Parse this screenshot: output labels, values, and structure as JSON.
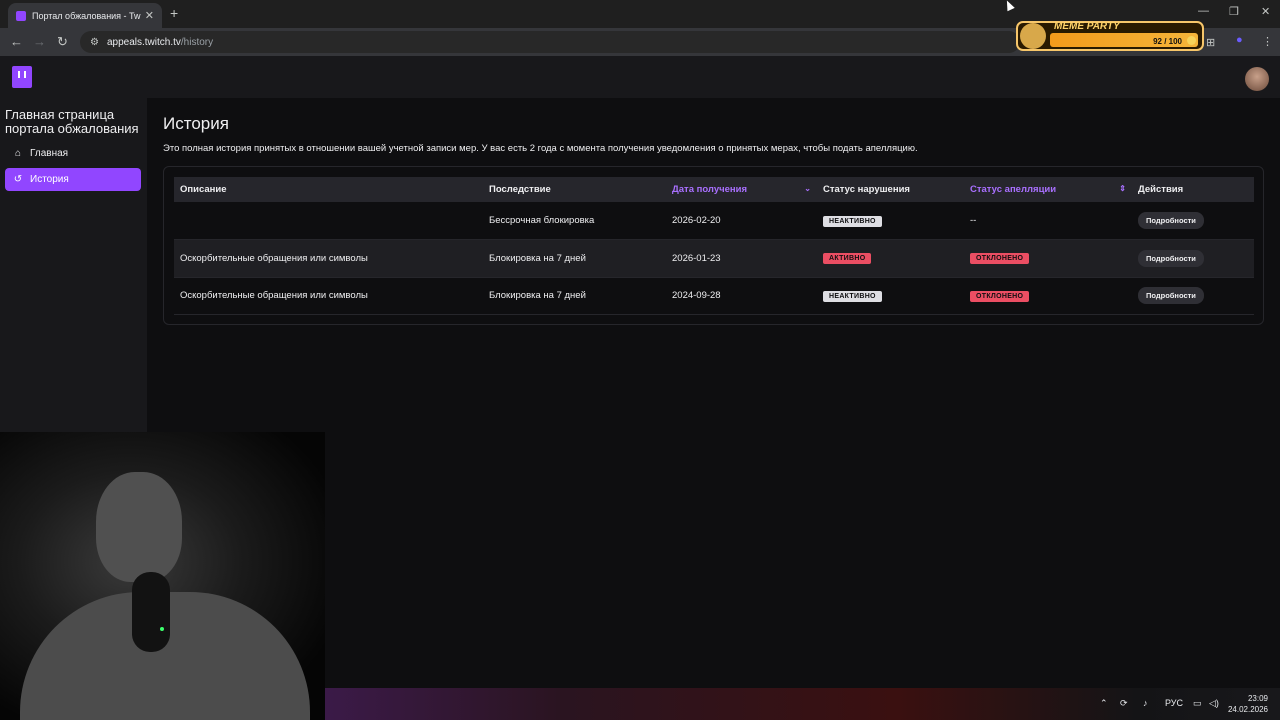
{
  "browser": {
    "tab_title": "Портал обжалования - Twitch",
    "tab_close": "✕",
    "new_tab": "+",
    "url_host": "appeals.twitch.tv",
    "url_path": "/history",
    "icons": [
      "back-icon",
      "forward-icon",
      "reload-icon",
      "site-settings-icon",
      "minimize-icon",
      "maximize-icon",
      "close-icon"
    ]
  },
  "extension": {
    "label": "MEME PARTY",
    "count": "92 / 100"
  },
  "sidebar": {
    "title": "Главная страница портала обжалования",
    "items": [
      {
        "label": "Главная",
        "icon": "home-icon"
      },
      {
        "label": "История",
        "icon": "history-icon",
        "active": true
      }
    ]
  },
  "main": {
    "title": "История",
    "description": "Это полная история принятых в отношении вашей учетной записи мер. У вас есть 2 года с момента получения уведомления о принятых мерах, чтобы подать апелляцию.",
    "columns": [
      "Описание",
      "Последствие",
      "Дата получения",
      "Статус нарушения",
      "Статус апелляции",
      "Действия"
    ],
    "rows": [
      {
        "description": "",
        "consequence": "Бессрочная блокировка",
        "date": "2026-02-20",
        "violation": "НЕАКТИВНО",
        "appeal": "--",
        "action": "Подробности"
      },
      {
        "description": "Оскорбительные обращения или символы",
        "consequence": "Блокировка на 7 дней",
        "date": "2026-01-23",
        "violation": "АКТИВНО",
        "appeal": "ОТКЛОНЕНО",
        "action": "Подробности"
      },
      {
        "description": "Оскорбительные обращения или символы",
        "consequence": "Блокировка на 7 дней",
        "date": "2024-09-28",
        "violation": "НЕАКТИВНО",
        "appeal": "ОТКЛОНЕНО",
        "action": "Подробности"
      }
    ]
  },
  "taskbar": {
    "lang": "РУС",
    "time": "23:09",
    "date": "24.02.2026"
  },
  "colors": {
    "accent": "#9146ff",
    "sort_header": "#a970ff",
    "danger": "#eb4e63"
  }
}
